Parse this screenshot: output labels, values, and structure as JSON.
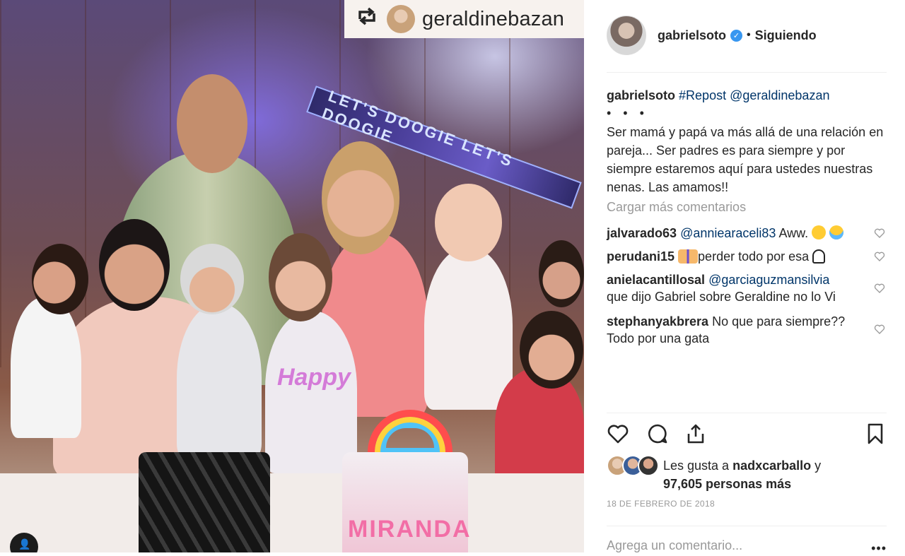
{
  "photo": {
    "repost_user": "geraldinebazan",
    "repost_icon": "repost-icon",
    "banner_text": "LET'S DOOGIE  LET'S DOOGIE",
    "shirt_text": "Happy",
    "cake_text": "MIRANDA"
  },
  "header": {
    "username": "gabrielsoto",
    "separator": "•",
    "follow_status": "Siguiendo"
  },
  "caption": {
    "username": "gabrielsoto",
    "hashtag": "#Repost",
    "mention": "@geraldinebazan",
    "ellipsis": "• • •",
    "text": "Ser mamá y papá va más allá de una relación en pareja... Ser padres es para siempre y por siempre estaremos aquí para ustedes nuestras nenas. Las amamos!!"
  },
  "load_more_label": "Cargar más comentarios",
  "comments": [
    {
      "user": "jalvarado63",
      "mention": "@anniearaceli83",
      "text": " Aww. "
    },
    {
      "user": "perudani15",
      "text": "perder todo por esa "
    },
    {
      "user": "anielacantillosal",
      "mention": "@garciaguzmansilvia",
      "text": "que dijo Gabriel sobre Geraldine no lo Vi"
    },
    {
      "user": "stephanyakbrera",
      "text": " No que para siempre?? Todo por una gata"
    }
  ],
  "likes": {
    "prefix": "Les gusta a ",
    "user": "nadxcarballo",
    "conj": " y",
    "count": "97,605 personas más"
  },
  "date": "18 DE FEBRERO DE 2018",
  "add_comment_placeholder": "Agrega un comentario...",
  "more_label": "•••",
  "colors": {
    "link": "#003569",
    "muted": "#999999",
    "verified": "#3897f0"
  }
}
